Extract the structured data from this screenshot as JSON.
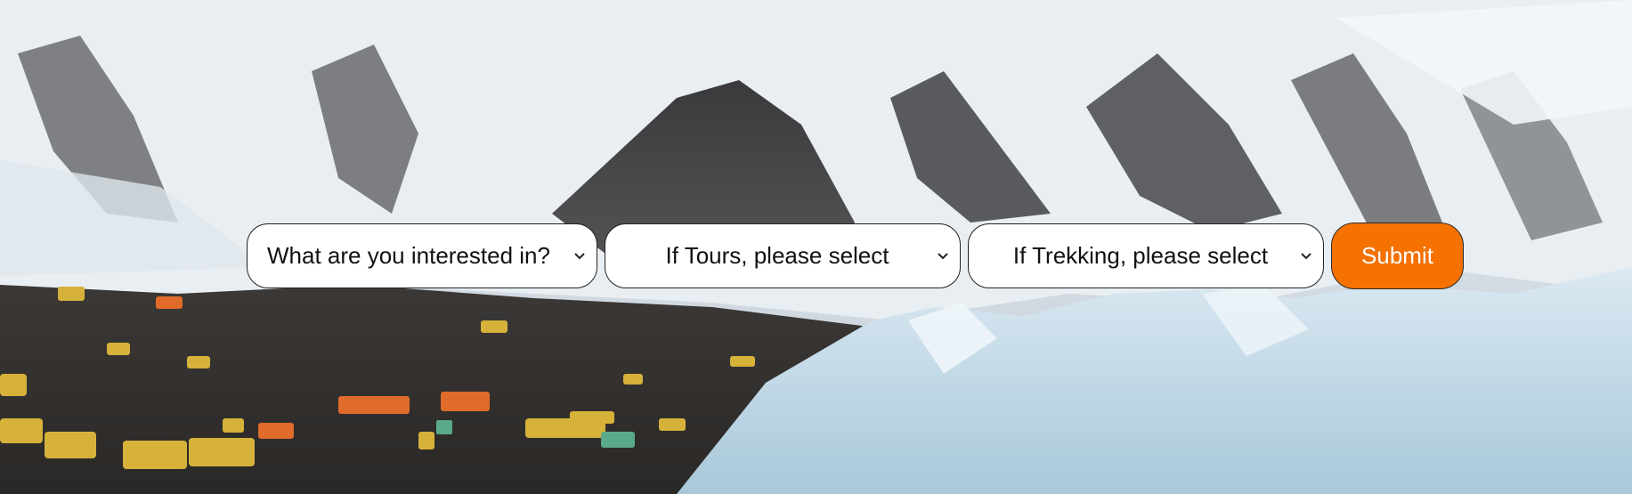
{
  "hero": {
    "background_image": "mountain-base-camp-photo"
  },
  "form": {
    "interest_select": {
      "selected": "What are you interested in?"
    },
    "tours_select": {
      "selected": "If Tours, please select"
    },
    "trekking_select": {
      "selected": "If Trekking, please select"
    },
    "submit_label": "Submit",
    "submit_color": "#f57100",
    "chevron_icon": "chevron-down-icon"
  }
}
